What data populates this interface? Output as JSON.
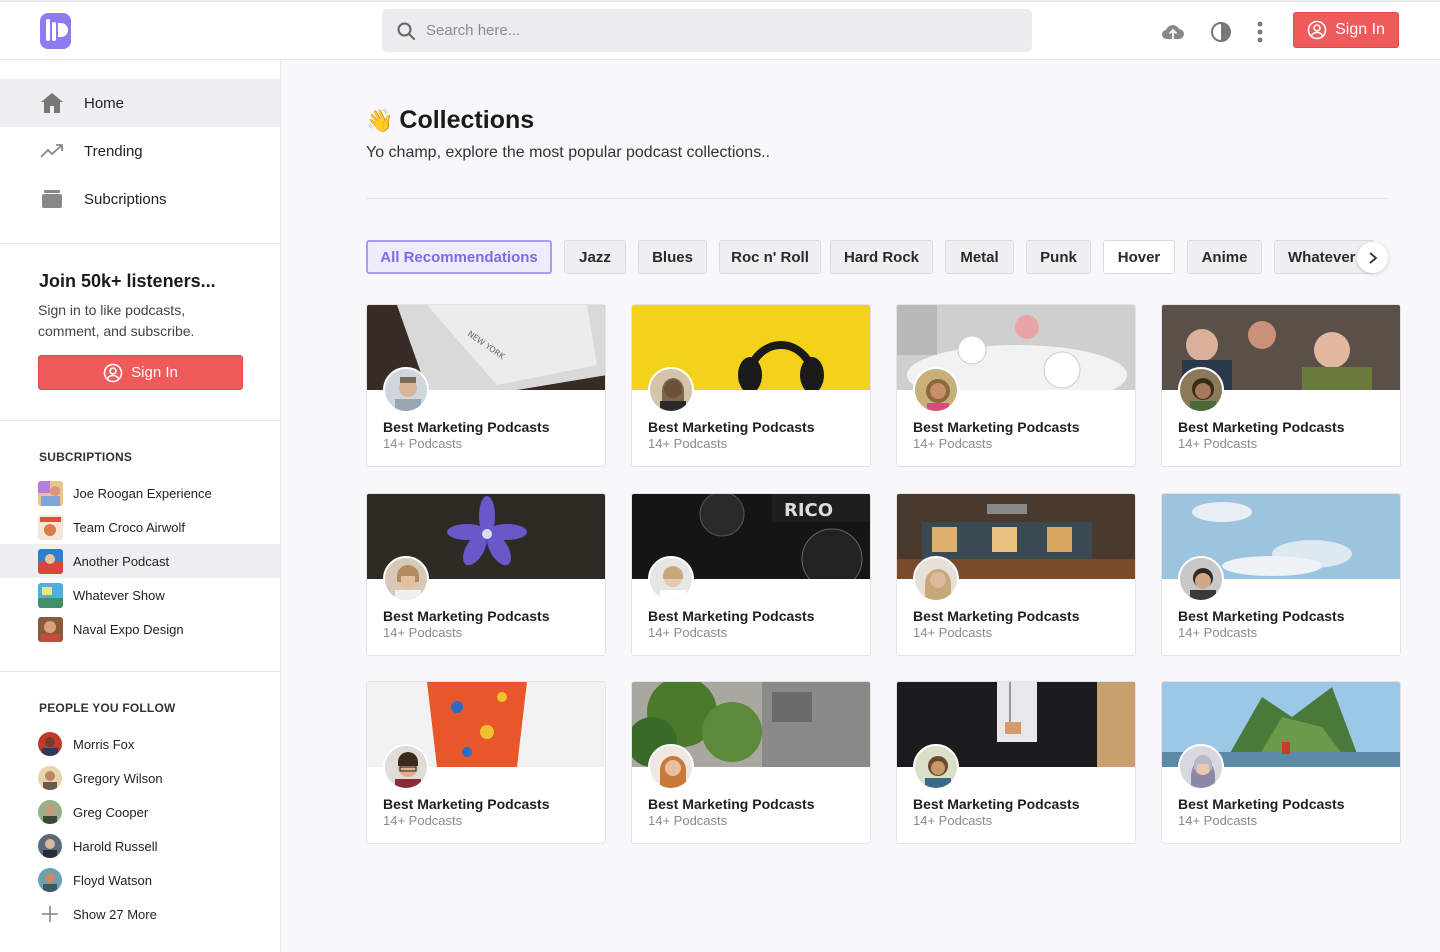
{
  "header": {
    "search_placeholder": "Search here...",
    "signin_label": "Sign In"
  },
  "sidebar": {
    "nav": [
      {
        "label": "Home",
        "icon": "home-icon"
      },
      {
        "label": "Trending",
        "icon": "trending-icon"
      },
      {
        "label": "Subcriptions",
        "icon": "subscriptions-icon"
      }
    ],
    "join": {
      "title": "Join 50k+ listeners...",
      "text": "Sign in to like podcasts, comment, and subscribe.",
      "button": "Sign In"
    },
    "subscriptions_title": "SUBCRIPTIONS",
    "subscriptions": [
      {
        "label": "Joe Roogan Experience"
      },
      {
        "label": "Team Croco Airwolf"
      },
      {
        "label": "Another Podcast"
      },
      {
        "label": "Whatever Show"
      },
      {
        "label": "Naval Expo Design"
      }
    ],
    "people_title": "PEOPLE YOU FOLLOW",
    "people": [
      {
        "label": "Morris Fox"
      },
      {
        "label": "Gregory Wilson"
      },
      {
        "label": "Greg Cooper"
      },
      {
        "label": "Harold Russell"
      },
      {
        "label": "Floyd Watson"
      }
    ],
    "show_more": "Show 27 More"
  },
  "main": {
    "title_emoji": "👋",
    "title": "Collections",
    "subtitle": "Yo champ, explore the most popular podcast collections..",
    "chips": [
      "All Recommendations",
      "Jazz",
      "Blues",
      "Roc n' Roll",
      "Hard Rock",
      "Metal",
      "Punk",
      "Hover",
      "Anime",
      "Whatever"
    ],
    "cards": [
      {
        "title": "Best Marketing Podcasts",
        "subtitle": "14+ Podcasts"
      },
      {
        "title": "Best Marketing Podcasts",
        "subtitle": "14+ Podcasts"
      },
      {
        "title": "Best Marketing Podcasts",
        "subtitle": "14+ Podcasts"
      },
      {
        "title": "Best Marketing Podcasts",
        "subtitle": "14+ Podcasts"
      },
      {
        "title": "Best Marketing Podcasts",
        "subtitle": "14+ Podcasts"
      },
      {
        "title": "Best Marketing Podcasts",
        "subtitle": "14+ Podcasts"
      },
      {
        "title": "Best Marketing Podcasts",
        "subtitle": "14+ Podcasts"
      },
      {
        "title": "Best Marketing Podcasts",
        "subtitle": "14+ Podcasts"
      },
      {
        "title": "Best Marketing Podcasts",
        "subtitle": "14+ Podcasts"
      },
      {
        "title": "Best Marketing Podcasts",
        "subtitle": "14+ Podcasts"
      },
      {
        "title": "Best Marketing Podcasts",
        "subtitle": "14+ Podcasts"
      },
      {
        "title": "Best Marketing Podcasts",
        "subtitle": "14+ Podcasts"
      }
    ]
  },
  "colors": {
    "accent": "#ef5a5a",
    "brand": "#8b7cf0",
    "chip_active": "#7c6bea"
  }
}
